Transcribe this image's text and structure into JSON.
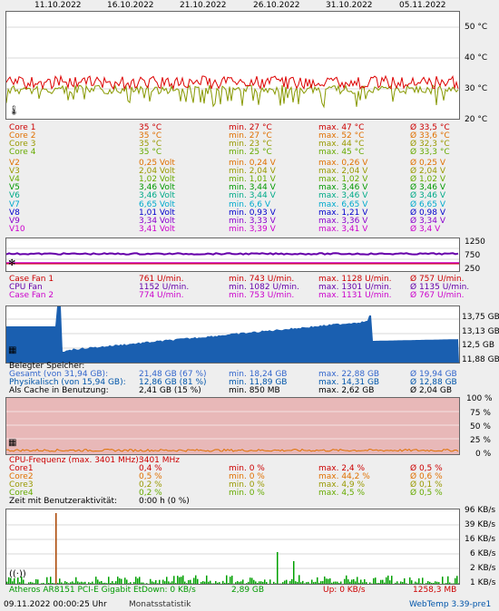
{
  "dates": [
    "11.10.2022",
    "16.10.2022",
    "21.10.2022",
    "26.10.2022",
    "31.10.2022",
    "05.11.2022"
  ],
  "temp_axis": [
    "50 °C",
    "40 °C",
    "30 °C",
    "20 °C"
  ],
  "temp_rows": [
    {
      "label": "Core 1",
      "cur": "35 °C",
      "min": "min. 27 °C",
      "max": "max. 47 °C",
      "avg": "Ø 33,5 °C",
      "color": "#cc0000"
    },
    {
      "label": "Core 2",
      "cur": "35 °C",
      "min": "min. 27 °C",
      "max": "max. 52 °C",
      "avg": "Ø 33,6 °C",
      "color": "#e07000"
    },
    {
      "label": "Core 3",
      "cur": "35 °C",
      "min": "min. 23 °C",
      "max": "max. 44 °C",
      "avg": "Ø 32,3 °C",
      "color": "#999900"
    },
    {
      "label": "Core 4",
      "cur": "35 °C",
      "min": "min. 25 °C",
      "max": "max. 45 °C",
      "avg": "Ø 33,3 °C",
      "color": "#66aa00"
    }
  ],
  "volt_rows": [
    {
      "label": "V2",
      "cur": "0,25 Volt",
      "min": "min. 0,24 V",
      "max": "max. 0,26 V",
      "avg": "Ø 0,25 V",
      "color": "#e07000"
    },
    {
      "label": "V3",
      "cur": "2,04 Volt",
      "min": "min. 2,04 V",
      "max": "max. 2,04 V",
      "avg": "Ø 2,04 V",
      "color": "#999900"
    },
    {
      "label": "V4",
      "cur": "1,02 Volt",
      "min": "min. 1,01 V",
      "max": "max. 1,02 V",
      "avg": "Ø 1,02 V",
      "color": "#66aa00"
    },
    {
      "label": "V5",
      "cur": "3,46 Volt",
      "min": "min. 3,44 V",
      "max": "max. 3,46 V",
      "avg": "Ø 3,46 V",
      "color": "#009900"
    },
    {
      "label": "V6",
      "cur": "3,46 Volt",
      "min": "min. 3,44 V",
      "max": "max. 3,46 V",
      "avg": "Ø 3,46 V",
      "color": "#00aa88"
    },
    {
      "label": "V7",
      "cur": "6,65 Volt",
      "min": "min. 6,6 V",
      "max": "max. 6,65 V",
      "avg": "Ø 6,65 V",
      "color": "#00aacc"
    },
    {
      "label": "V8",
      "cur": "1,01 Volt",
      "min": "min. 0,93 V",
      "max": "max. 1,21 V",
      "avg": "Ø 0,98 V",
      "color": "#0000cc"
    },
    {
      "label": "V9",
      "cur": "3,34 Volt",
      "min": "min. 3,33 V",
      "max": "max. 3,36 V",
      "avg": "Ø 3,34 V",
      "color": "#8800cc"
    },
    {
      "label": "V10",
      "cur": "3,41 Volt",
      "min": "min. 3,39 V",
      "max": "max. 3,41 V",
      "avg": "Ø 3,4 V",
      "color": "#cc00cc"
    }
  ],
  "fan_axis": [
    "1250",
    "750",
    "250"
  ],
  "fan_rows": [
    {
      "label": "Case Fan 1",
      "cur": "761 U/min.",
      "min": "min. 743 U/min.",
      "max": "max. 1128 U/min.",
      "avg": "Ø 757 U/min.",
      "color": "#cc0000"
    },
    {
      "label": "CPU Fan",
      "cur": "1152 U/min.",
      "min": "min. 1082 U/min.",
      "max": "max. 1301 U/min.",
      "avg": "Ø 1135 U/min.",
      "color": "#6600aa"
    },
    {
      "label": "Case Fan 2",
      "cur": "774 U/min.",
      "min": "min. 753 U/min.",
      "max": "max. 1131 U/min.",
      "avg": "Ø 767 U/min.",
      "color": "#cc00cc"
    }
  ],
  "mem_axis": [
    "13,75 GB",
    "13,13 GB",
    "12,5 GB",
    "11,88 GB"
  ],
  "mem_header": "Belegter Speicher:",
  "mem_rows": [
    {
      "label": "Gesamt (von 31,94 GB):",
      "cur": "21,48 GB (67 %)",
      "min": "min. 18,24 GB",
      "max": "max. 22,88 GB",
      "avg": "Ø 19,94 GB",
      "color": "#3366cc"
    },
    {
      "label": "Physikalisch (von 15,94 GB):",
      "cur": "12,86 GB (81 %)",
      "min": "min. 11,89 GB",
      "max": "max. 14,31 GB",
      "avg": "Ø 12,88 GB",
      "color": "#0055aa"
    },
    {
      "label": "Als Cache in Benutzung:",
      "cur": "2,41 GB (15 %)",
      "min": "min. 850 MB",
      "max": "max. 2,62 GB",
      "avg": "Ø 2,04 GB",
      "color": "#000000"
    }
  ],
  "cpu_axis": [
    "100 %",
    "75 %",
    "50 %",
    "25 %",
    "0 %"
  ],
  "cpu_header_label": "CPU-Frequenz (max. 3401 MHz):",
  "cpu_header_value": "3401 MHz",
  "cpu_rows": [
    {
      "label": "Core1",
      "cur": "0,4 %",
      "min": "min. 0 %",
      "max": "max. 2,4 %",
      "avg": "Ø 0,5 %",
      "color": "#cc0000"
    },
    {
      "label": "Core2",
      "cur": "0,5 %",
      "min": "min. 0 %",
      "max": "max. 44,2 %",
      "avg": "Ø 0,6 %",
      "color": "#e07000"
    },
    {
      "label": "Core3",
      "cur": "0,2 %",
      "min": "min. 0 %",
      "max": "max. 4,9 %",
      "avg": "Ø 0,1 %",
      "color": "#999900"
    },
    {
      "label": "Core4",
      "cur": "0,2 %",
      "min": "min. 0 %",
      "max": "max. 4,5 %",
      "avg": "Ø 0,5 %",
      "color": "#66aa00"
    }
  ],
  "activity_label": "Zeit mit Benutzeraktivität:",
  "activity_value": "0:00 h (0 %)",
  "net_axis": [
    "96 KB/s",
    "39 KB/s",
    "16 KB/s",
    "6 KB/s",
    "2 KB/s",
    "1 KB/s"
  ],
  "net_row": {
    "adapter": "Atheros AR8151 PCI-E Gigabit Et",
    "down": "Down: 0 KB/s",
    "down_total": "2,89 GB",
    "up": "Up: 0 KB/s",
    "up_total": "1258,3 MB"
  },
  "footer": {
    "timestamp": "09.11.2022 00:00:25 Uhr",
    "link": "Monatsstatistik",
    "app": "WebTemp 3.39-pre1"
  },
  "colors": {
    "mem_fill": "#1a5fb0",
    "cpu_bg": "#e8b8b8",
    "net_bar": "#00a000",
    "temp_red": "#dd0000",
    "temp_olive": "#889900"
  }
}
